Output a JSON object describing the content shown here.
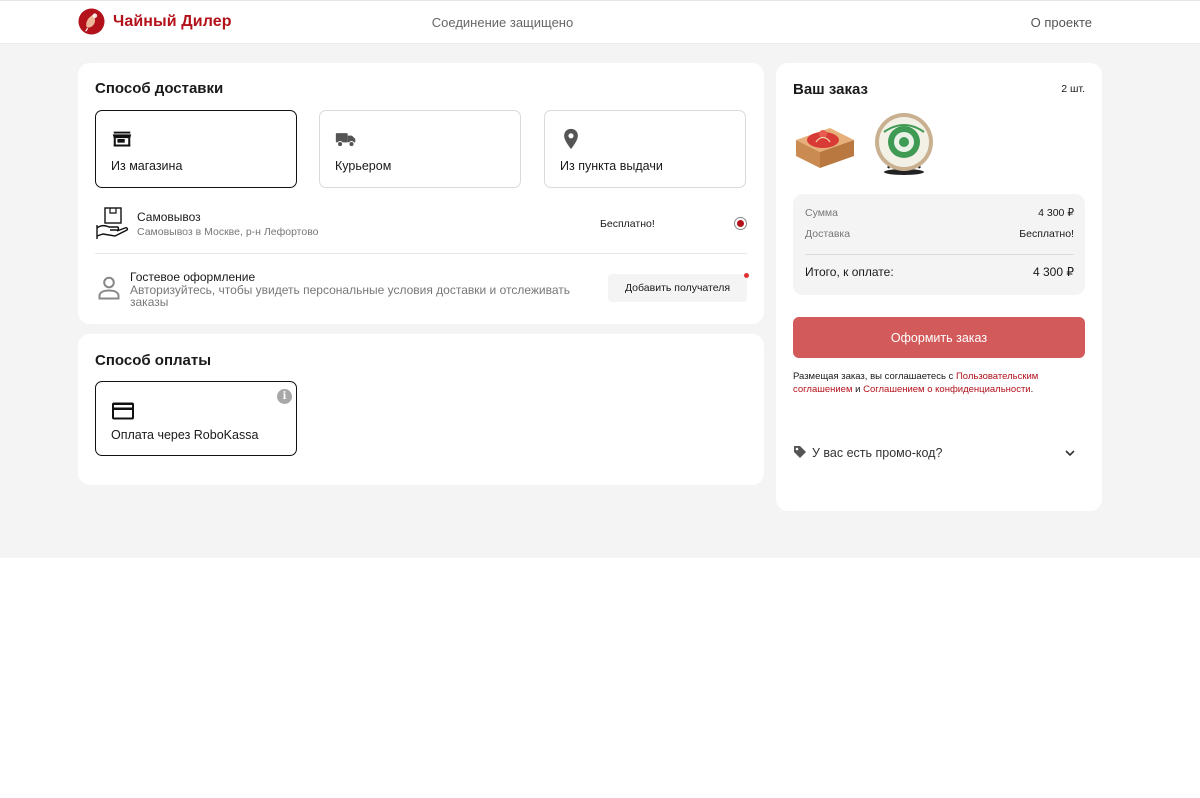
{
  "header": {
    "brand": "Чайный Дилер",
    "secure": "Соединение защищено",
    "about": "О проекте",
    "brand_color": "#b3121b"
  },
  "delivery": {
    "title": "Способ доставки",
    "options": [
      {
        "label": "Из магазина",
        "icon": "store-icon",
        "selected": true
      },
      {
        "label": "Курьером",
        "icon": "truck-icon",
        "selected": false
      },
      {
        "label": "Из пункта выдачи",
        "icon": "map-pin-icon",
        "selected": false
      }
    ],
    "pickup": {
      "title": "Самовывоз",
      "subtitle": "Самовывоз в Москве, р-н Лефортово",
      "price": "Бесплатно!",
      "selected": true
    },
    "guest": {
      "title": "Гостевое оформление",
      "subtitle": "Авторизуйтесь, чтобы увидеть персональные условия доставки и отслеживать заказы",
      "button": "Добавить получателя"
    }
  },
  "payment": {
    "title": "Способ оплаты",
    "option": {
      "label": "Оплата через RoboKassa",
      "icon": "credit-card-icon",
      "info": "i"
    }
  },
  "order": {
    "title": "Ваш заказ",
    "count": "2 шт.",
    "items": [
      "tea-box-product",
      "pu-erh-cake-product"
    ],
    "summary": {
      "sum_label": "Сумма",
      "sum_value": "4 300 ₽",
      "delivery_label": "Доставка",
      "delivery_value": "Бесплатно!",
      "total_label": "Итого, к оплате:",
      "total_value": "4 300 ₽"
    },
    "submit": "Оформить заказ",
    "agree_prefix": "Размещая заказ, вы соглашаетесь с ",
    "agree_link1": "Пользовательским соглашением",
    "agree_mid": " и ",
    "agree_link2": "Соглашением о конфиденциальности",
    "agree_suffix": ".",
    "promo": "У вас есть промо-код?",
    "submit_color": "#d25a5a"
  }
}
